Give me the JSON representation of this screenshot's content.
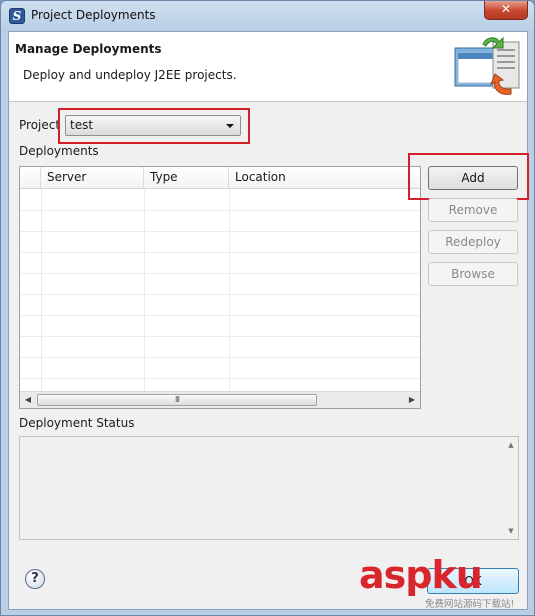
{
  "window": {
    "title": "Project Deployments",
    "close_label": "✕"
  },
  "banner": {
    "title": "Manage Deployments",
    "description": "Deploy and undeploy J2EE projects."
  },
  "project": {
    "label": "Project",
    "selected": "test"
  },
  "deployments": {
    "label": "Deployments",
    "columns": [
      "",
      "Server",
      "Type",
      "Location"
    ],
    "scroll_thumb": "III"
  },
  "buttons": {
    "add": "Add",
    "remove": "Remove",
    "redeploy": "Redeploy",
    "browse": "Browse"
  },
  "status": {
    "label": "Deployment Status"
  },
  "footer": {
    "help": "?",
    "ok": "OK"
  },
  "watermark": {
    "text": "aspku",
    "sub": "免费网站源码下载站!"
  },
  "colors": {
    "highlight_red": "#d3202a",
    "title_gradient": "#b9cfe6"
  }
}
